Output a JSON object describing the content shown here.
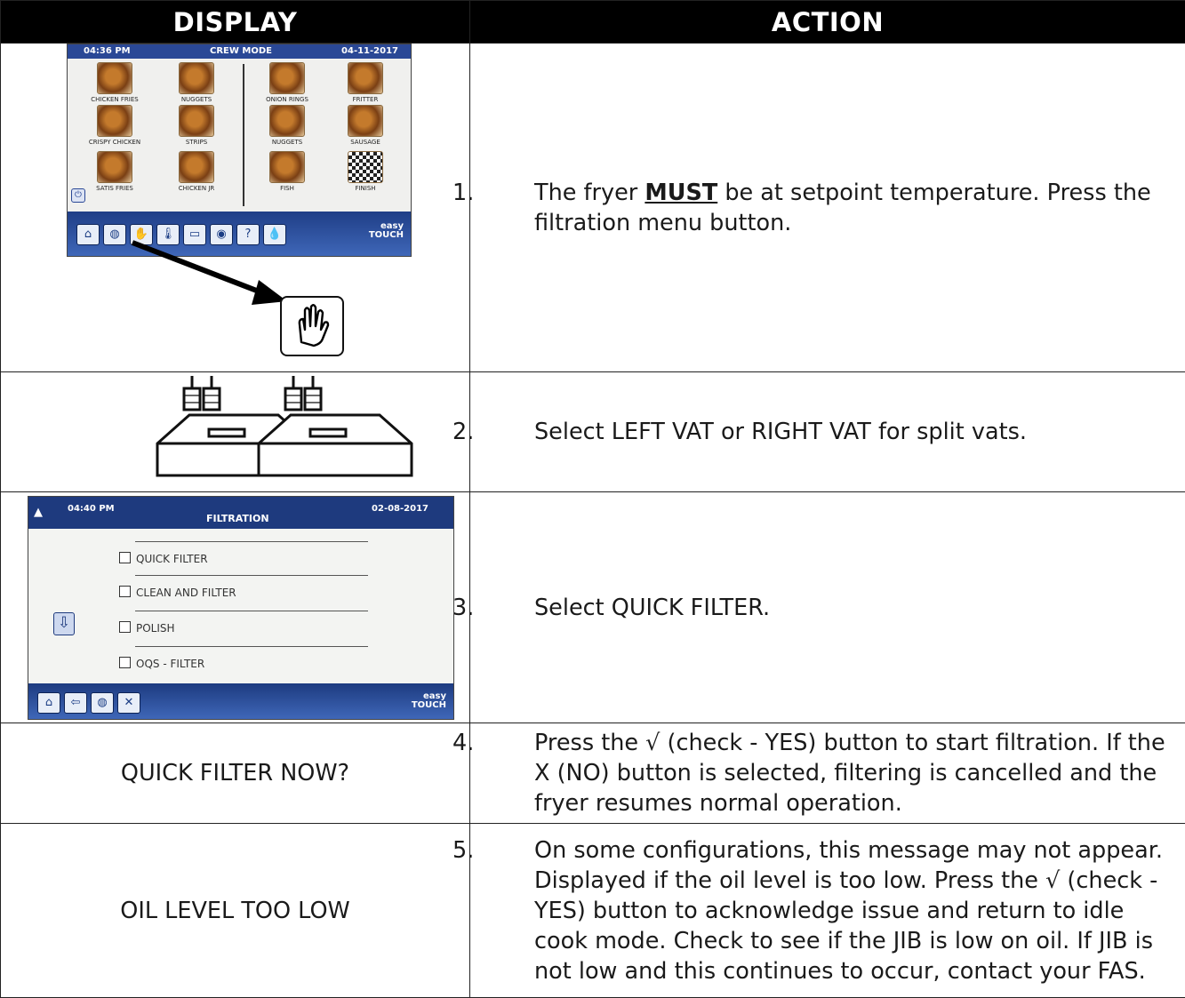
{
  "headers": {
    "display": "DISPLAY",
    "action": "ACTION"
  },
  "crew_screen": {
    "time": "04:36 PM",
    "title": "CREW MODE",
    "date": "04-11-2017",
    "tiles": [
      "CHICKEN FRIES",
      "NUGGETS",
      "ONION RINGS",
      "FRITTER",
      "CRISPY CHICKEN",
      "STRIPS",
      "NUGGETS",
      "SAUSAGE",
      "SATIS FRIES",
      "CHICKEN JR",
      "FISH",
      "FINISH"
    ],
    "brand_line1": "easy",
    "brand_line2": "TOUCH",
    "help_label": "?"
  },
  "filtration_screen": {
    "time": "04:40 PM",
    "title": "FILTRATION",
    "date": "02-08-2017",
    "options": [
      "QUICK FILTER",
      "CLEAN AND FILTER",
      "POLISH",
      "OQS - FILTER"
    ],
    "brand_line1": "easy",
    "brand_line2": "TOUCH"
  },
  "steps": [
    {
      "num": "1.",
      "pre": "The fryer ",
      "emph": "MUST",
      "post": " be at setpoint temperature. Press the filtration menu button."
    },
    {
      "num": "2.",
      "text": "Select LEFT VAT or RIGHT VAT for split vats."
    },
    {
      "num": "3.",
      "text": "Select QUICK FILTER."
    },
    {
      "num": "4.",
      "display": "QUICK FILTER NOW?",
      "text": "Press the √ (check - YES) button to start filtration. If the X (NO) button is selected, filtering is cancelled and the fryer resumes normal operation."
    },
    {
      "num": "5.",
      "display": "OIL LEVEL TOO LOW",
      "text": "On some configurations, this message may not appear. Displayed if the oil level is too low.  Press the √ (check - YES) button to acknowledge issue and return to idle cook mode.   Check to see if the JIB is low on oil.  If JIB is not low and this continues to occur, contact your FAS."
    }
  ]
}
